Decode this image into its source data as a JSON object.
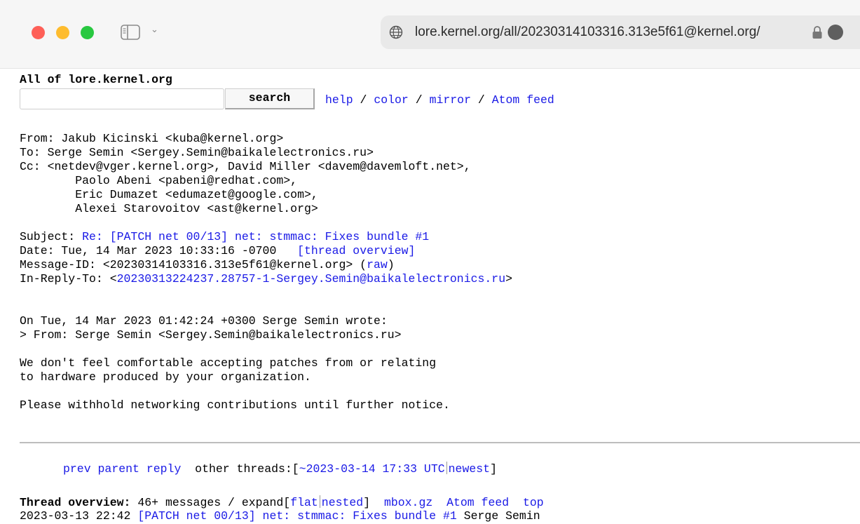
{
  "browser": {
    "url": "lore.kernel.org/all/20230314103316.313e5f61@kernel.org/"
  },
  "header": {
    "title": "All of lore.kernel.org",
    "search_button": "search",
    "search_value": "",
    "links": [
      "help",
      "color",
      "mirror",
      "Atom feed"
    ],
    "link_sep": " / "
  },
  "headers": {
    "from": "From: Jakub Kicinski <kuba@kernel.org>",
    "to": "To: Serge Semin <Sergey.Semin@baikalelectronics.ru>",
    "cc_lines": [
      "Cc: <netdev@vger.kernel.org>, David Miller <davem@davemloft.net>,",
      "        Paolo Abeni <pabeni@redhat.com>,",
      "        Eric Dumazet <edumazet@google.com>,",
      "        Alexei Starovoitov <ast@kernel.org>"
    ],
    "subject_label": "Subject: ",
    "subject": "Re: [PATCH net 00/13] net: stmmac: Fixes bundle #1",
    "date": "Date: Tue, 14 Mar 2023 10:33:16 -0700   ",
    "thread_overview_link": "[thread overview]",
    "message_id": "Message-ID: <20230314103316.313e5f61@kernel.org> (",
    "raw_link": "raw",
    "message_id_close": ")",
    "in_reply_to_label": "In-Reply-To: <",
    "in_reply_to": "20230313224237.28757-1-Sergey.Semin@baikalelectronics.ru",
    "in_reply_to_close": ">"
  },
  "body": {
    "lines": [
      "On Tue, 14 Mar 2023 01:42:24 +0300 Serge Semin wrote:",
      "> From: Serge Semin <Sergey.Semin@baikalelectronics.ru>",
      "",
      "We don't feel comfortable accepting patches from or relating",
      "to hardware produced by your organization.",
      "",
      "Please withhold networking contributions until further notice."
    ]
  },
  "nav": {
    "prev": "prev",
    "parent": "parent",
    "reply": "reply",
    "other_threads": "other threads:[",
    "date_link": "~2023-03-14 17:33 UTC",
    "newest": "newest",
    "close": "]"
  },
  "thread": {
    "label": "Thread overview:",
    "count": " 46+ messages / expand[",
    "flat": "flat",
    "nested": "nested",
    "close": "]",
    "mbox": "mbox.gz",
    "atom": "Atom feed",
    "top": "top",
    "first_entry_date": "2023-03-13 22:42 ",
    "first_entry_subject": "[PATCH net 00/13] net: stmmac: Fixes bundle #1",
    "first_entry_author": " Serge Semin"
  },
  "colors": {
    "link": "#1a1ae6",
    "traffic_red": "#fe5f57",
    "traffic_yellow": "#febc2e",
    "traffic_green": "#28c840"
  }
}
